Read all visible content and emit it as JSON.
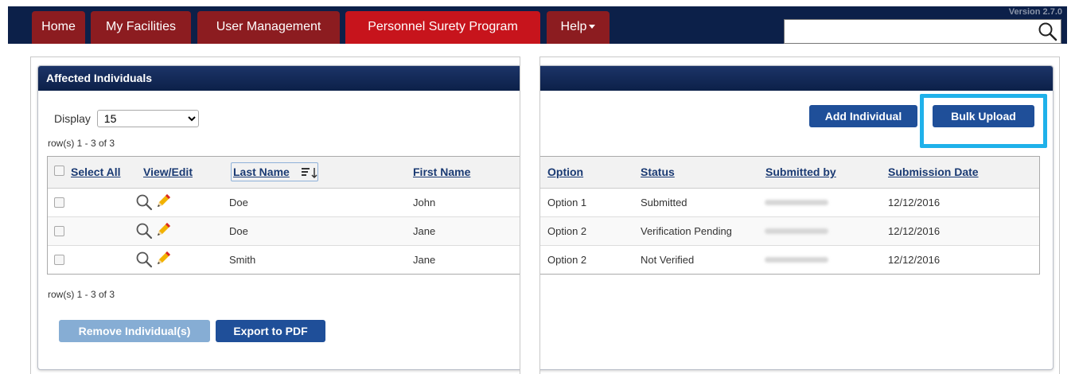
{
  "nav": {
    "tabs": [
      "Home",
      "My Facilities",
      "User Management",
      "Personnel Surety Program",
      "Help"
    ],
    "active_tab": "Personnel Surety Program",
    "version_text": "Version 2.7.0",
    "search_placeholder": ""
  },
  "panel": {
    "title": "Affected Individuals",
    "display_label": "Display",
    "display_value": "15",
    "row_count_text": "row(s) 1 - 3 of 3",
    "add_individual_label": "Add Individual",
    "bulk_upload_label": "Bulk Upload",
    "remove_label": "Remove Individual(s)",
    "export_label": "Export to PDF"
  },
  "table": {
    "headers": {
      "select_all": "Select All",
      "view_edit": "View/Edit",
      "last_name": "Last Name",
      "first_name": "First Name",
      "option": "Option",
      "status": "Status",
      "submitted_by": "Submitted by",
      "submission_date": "Submission Date"
    },
    "sort_column": "Last Name",
    "rows": [
      {
        "last": "Doe",
        "first": "John",
        "option": "Option 1",
        "status": "Submitted",
        "date": "12/12/2016"
      },
      {
        "last": "Doe",
        "first": "Jane",
        "option": "Option 2",
        "status": "Verification Pending",
        "date": "12/12/2016"
      },
      {
        "last": "Smith",
        "first": "Jane",
        "option": "Option 2",
        "status": "Not Verified",
        "date": "12/12/2016"
      }
    ]
  },
  "colors": {
    "nav_bg": "#0c2049",
    "tab_bg": "#8c1c20",
    "tab_active_bg": "#c7141c",
    "primary_button": "#1f4f99",
    "disabled_button": "#86add4",
    "highlight": "#1fb1ea"
  },
  "icons": [
    "search-icon",
    "magnifier-icon",
    "pencil-icon",
    "sort-icon",
    "chevron-down-icon"
  ]
}
